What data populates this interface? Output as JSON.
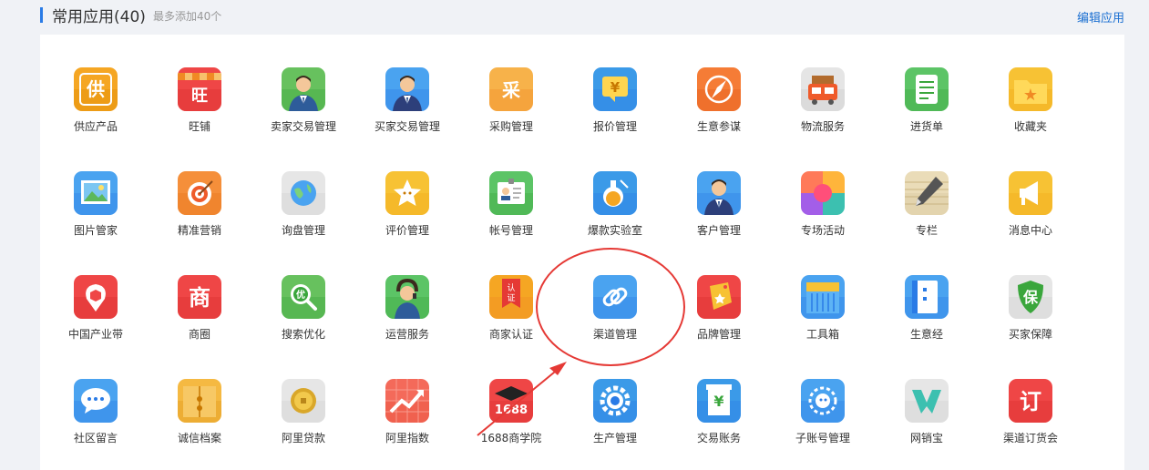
{
  "header": {
    "title": "常用应用(40)",
    "subtitle": "最多添加40个",
    "edit_label": "编辑应用"
  },
  "colors": {
    "accent": "#2a7be6",
    "annotation": "#e53935"
  },
  "apps": [
    {
      "label": "供应产品",
      "icon": "supply-icon",
      "glyph": "供"
    },
    {
      "label": "旺铺",
      "icon": "shop-icon",
      "glyph": "旺"
    },
    {
      "label": "卖家交易管理",
      "icon": "seller-icon",
      "glyph": ""
    },
    {
      "label": "买家交易管理",
      "icon": "buyer-icon",
      "glyph": ""
    },
    {
      "label": "采购管理",
      "icon": "purchase-icon",
      "glyph": "采"
    },
    {
      "label": "报价管理",
      "icon": "quote-icon",
      "glyph": "¥"
    },
    {
      "label": "生意参谋",
      "icon": "compass-icon",
      "glyph": ""
    },
    {
      "label": "物流服务",
      "icon": "truck-icon",
      "glyph": ""
    },
    {
      "label": "进货单",
      "icon": "order-list-icon",
      "glyph": ""
    },
    {
      "label": "收藏夹",
      "icon": "favorites-folder-icon",
      "glyph": "★"
    },
    {
      "label": "图片管家",
      "icon": "image-icon",
      "glyph": ""
    },
    {
      "label": "精准营销",
      "icon": "target-icon",
      "glyph": ""
    },
    {
      "label": "询盘管理",
      "icon": "globe-icon",
      "glyph": ""
    },
    {
      "label": "评价管理",
      "icon": "star-icon",
      "glyph": ""
    },
    {
      "label": "帐号管理",
      "icon": "id-card-icon",
      "glyph": ""
    },
    {
      "label": "爆款实验室",
      "icon": "flask-icon",
      "glyph": ""
    },
    {
      "label": "客户管理",
      "icon": "customer-icon",
      "glyph": ""
    },
    {
      "label": "专场活动",
      "icon": "petal-icon",
      "glyph": ""
    },
    {
      "label": "专栏",
      "icon": "pen-icon",
      "glyph": ""
    },
    {
      "label": "消息中心",
      "icon": "megaphone-icon",
      "glyph": ""
    },
    {
      "label": "中国产业带",
      "icon": "location-icon",
      "glyph": ""
    },
    {
      "label": "商圈",
      "icon": "business-circle-icon",
      "glyph": "商"
    },
    {
      "label": "搜索优化",
      "icon": "search-icon",
      "glyph": "优"
    },
    {
      "label": "运营服务",
      "icon": "headset-icon",
      "glyph": ""
    },
    {
      "label": "商家认证",
      "icon": "certification-icon",
      "glyph": "认证"
    },
    {
      "label": "渠道管理",
      "icon": "link-icon",
      "glyph": ""
    },
    {
      "label": "品牌管理",
      "icon": "brand-tag-icon",
      "glyph": ""
    },
    {
      "label": "工具箱",
      "icon": "toolbox-icon",
      "glyph": ""
    },
    {
      "label": "生意经",
      "icon": "notebook-icon",
      "glyph": ""
    },
    {
      "label": "买家保障",
      "icon": "shield-icon",
      "glyph": "保"
    },
    {
      "label": "社区留言",
      "icon": "chat-icon",
      "glyph": ""
    },
    {
      "label": "诚信档案",
      "icon": "file-folder-icon",
      "glyph": ""
    },
    {
      "label": "阿里贷款",
      "icon": "coin-icon",
      "glyph": ""
    },
    {
      "label": "阿里指数",
      "icon": "trend-chart-icon",
      "glyph": ""
    },
    {
      "label": "1688商学院",
      "icon": "graduation-cap-icon",
      "glyph": "1688"
    },
    {
      "label": "生产管理",
      "icon": "gear-icon",
      "glyph": ""
    },
    {
      "label": "交易账务",
      "icon": "receipt-icon",
      "glyph": "¥"
    },
    {
      "label": "子账号管理",
      "icon": "sub-account-icon",
      "glyph": ""
    },
    {
      "label": "网销宝",
      "icon": "wangxiao-logo-icon",
      "glyph": ""
    },
    {
      "label": "渠道订货会",
      "icon": "order-meeting-icon",
      "glyph": "订"
    }
  ]
}
